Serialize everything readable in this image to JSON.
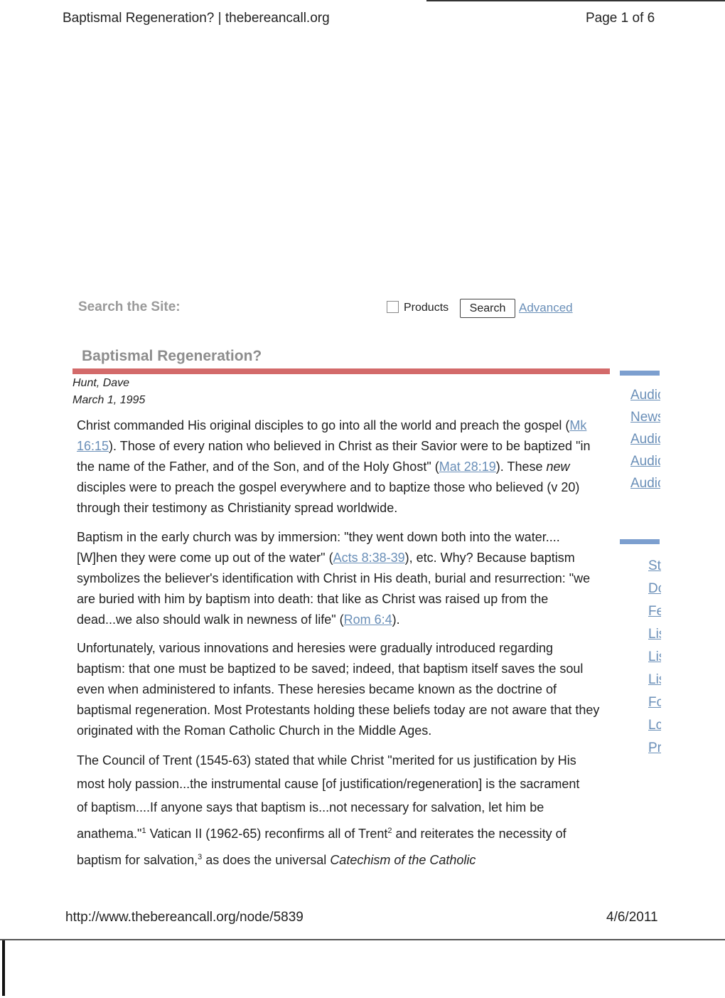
{
  "print_header": {
    "title": "Baptismal Regeneration? | thebereancall.org",
    "page": "Page 1 of 6"
  },
  "search": {
    "label": "Search the Site:",
    "products_label": "Products",
    "products_checked": false,
    "button": "Search",
    "advanced": "Advanced"
  },
  "article": {
    "title": "Baptismal Regeneration?",
    "author": "Hunt, Dave",
    "date": "March 1, 1995",
    "p1": {
      "a": "Christ commanded His original disciples to go into all the world and preach the gospel (",
      "l1": "Mk 16:15",
      "b": "). Those of every nation who believed in Christ as their Savior were to be baptized \"in the name of the Father, and of the Son, and of the Holy Ghost\" (",
      "l2": "Mat 28:19",
      "c": "). These ",
      "em": "new",
      "d": " disciples were to preach the gospel everywhere and to baptize those who believed (v 20) through their testimony as Christianity spread worldwide."
    },
    "p2": {
      "a": "Baptism in the early church was by immersion: \"they went down both into the water.... [W]hen they were come up out of the water\" (",
      "l1": "Acts 8:38-39",
      "b": "), etc. Why? Because baptism symbolizes the believer's identification with Christ in His death, burial and resurrection: \"we are buried with him by baptism into death: that like as Christ was raised up from the dead...we also should walk in newness of life\" (",
      "l2": "Rom 6:4",
      "c": ")."
    },
    "p3": "Unfortunately, various innovations and heresies were gradually introduced regarding baptism: that one must be baptized to be saved; indeed, that baptism itself saves the soul even when administered to infants. These heresies became known as the doctrine of baptismal regeneration. Most Protestants holding these beliefs today are not aware that they originated with the Roman Catholic Church in the Middle Ages.",
    "p4": {
      "a": "The Council of Trent (1545-63) stated that while Christ \"merited for us justification by His most holy passion...the instrumental cause [of justification/regeneration] is the sacrament of baptism....If anyone says that baptism is...not necessary for salvation, let him be anathema.\"",
      "s1": "1",
      "b": " Vatican II (1962-65) reconfirms all of Trent",
      "s2": "2",
      "c": " and reiterates the necessity of baptism for salvation,",
      "s3": "3",
      "d": " as does the universal ",
      "em": "Catechism of the Catholic"
    }
  },
  "sidebar": {
    "group1": [
      "Audic",
      "News",
      "Audic",
      "Audic",
      "Audic"
    ],
    "group2": [
      "St",
      "Dc",
      "Fe",
      "Lis",
      "Lis",
      "Lis",
      "Fc",
      "Lc",
      "Pr"
    ]
  },
  "print_footer": {
    "url": "http://www.thebereancall.org/node/5839",
    "date": "4/6/2011"
  },
  "colors": {
    "link": "#6a8fb8",
    "title_bar": "#d36a6a",
    "sidebar_bar": "#7c9fcf"
  }
}
